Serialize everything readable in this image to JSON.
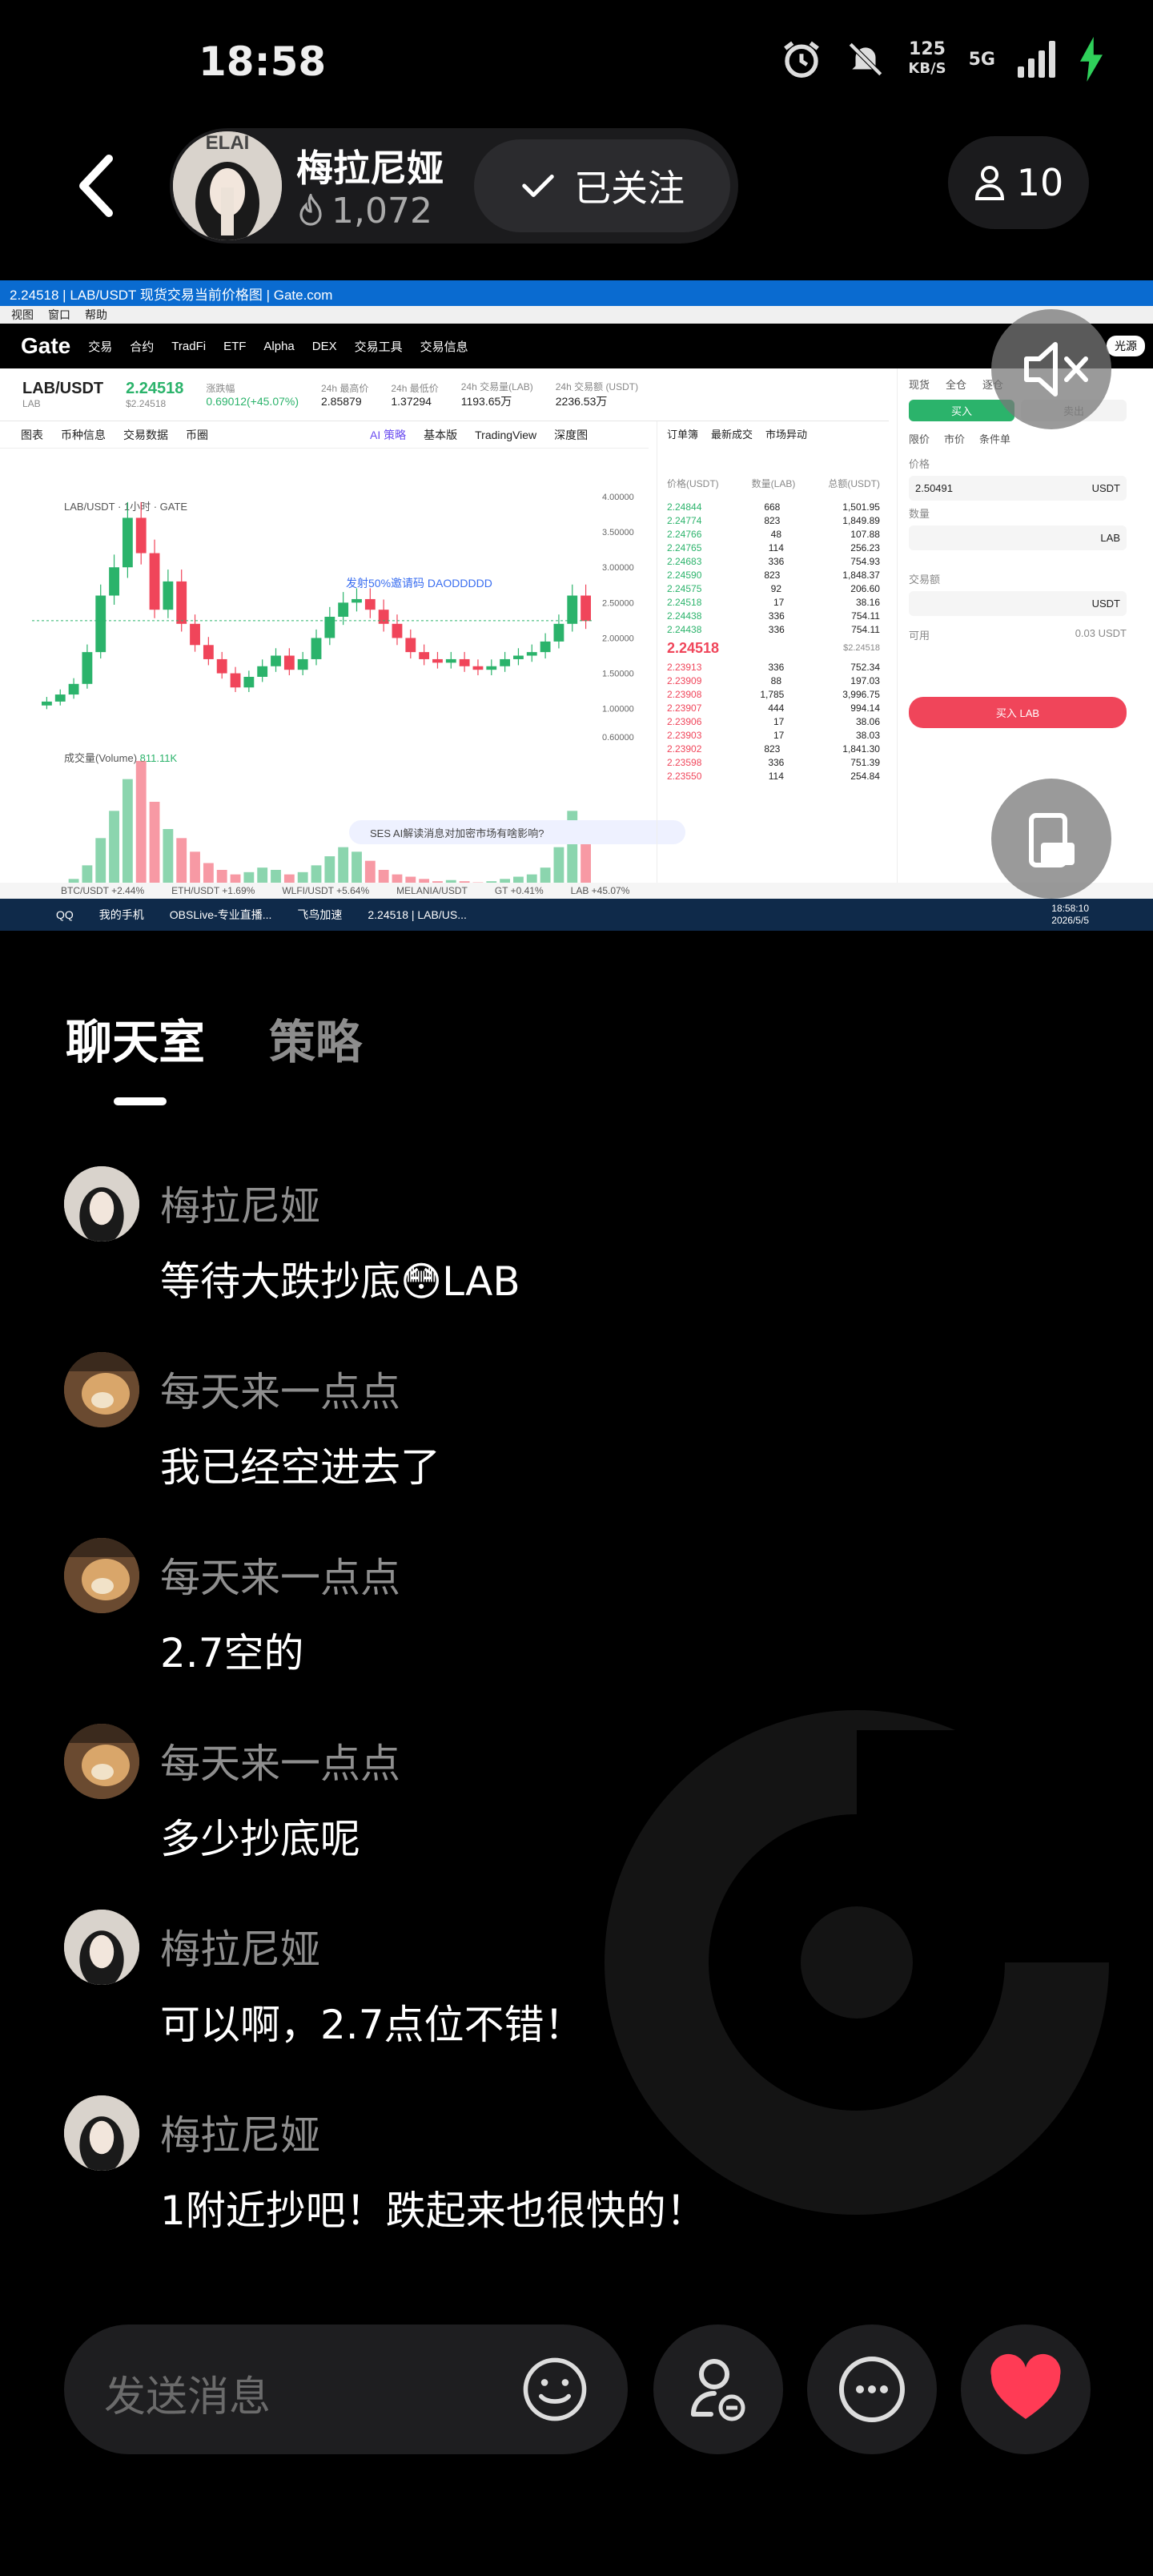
{
  "status_bar": {
    "time": "18:58",
    "net_speed_value": "125",
    "net_speed_unit": "KB/S",
    "network_type": "5G"
  },
  "header": {
    "host_name": "梅拉尼娅",
    "host_likes": "1,072",
    "follow_label": "已关注",
    "viewer_count": "10"
  },
  "stream": {
    "window_title": "2.24518 | LAB/USDT 现货交易当前价格图 | Gate.com",
    "window_menu": [
      "视图",
      "窗口",
      "帮助"
    ],
    "nav_items": [
      "交易",
      "合约",
      "TradFi",
      "ETF",
      "Alpha",
      "DEX",
      "交易工具",
      "交易信息"
    ],
    "logo": "Gate",
    "theme_toggle": "光源",
    "pair": "LAB/USDT",
    "pair_sub": "LAB",
    "last_price": "2.24518",
    "last_price_usd": "$2.24518",
    "change_label": "涨跌幅",
    "change_value": "0.69012(+45.07%)",
    "high_label": "24h 最高价",
    "high_value": "2.85879",
    "low_label": "24h 最低价",
    "low_value": "1.37294",
    "vol_label": "24h 交易量(LAB)",
    "vol_value": "1193.65万",
    "amount_label": "24h 交易额 (USDT)",
    "amount_value": "2236.53万",
    "tabs": [
      "图表",
      "币种信息",
      "交易数据",
      "币圈"
    ],
    "chart_tabs": [
      "AI 策略",
      "基本版",
      "TradingView",
      "深度图"
    ],
    "chart_header": "LAB/USDT · 1小时 · GATE",
    "chart_annotation": "发射50%邀请码 DAODDDDD",
    "volume_label": "成交量(Volume)",
    "volume_value": "811.11K",
    "y_ticks": [
      "4.00000",
      "3.50000",
      "3.00000",
      "2.50000",
      "2.00000",
      "1.50000",
      "1.00000",
      "0.60000"
    ],
    "book_tabs": [
      "订单簿",
      "最新成交",
      "市场异动"
    ],
    "book_header": [
      "价格(USDT)",
      "数量(LAB)",
      "总额(USDT)"
    ],
    "asks": [
      [
        "2.24844",
        "668",
        "1,501.95"
      ],
      [
        "2.24774",
        "823",
        "1,849.89"
      ],
      [
        "2.24766",
        "48",
        "107.88"
      ],
      [
        "2.24765",
        "114",
        "256.23"
      ],
      [
        "2.24683",
        "336",
        "754.93"
      ],
      [
        "2.24590",
        "823",
        "1,848.37"
      ],
      [
        "2.24575",
        "92",
        "206.60"
      ],
      [
        "2.24518",
        "17",
        "38.16"
      ],
      [
        "2.24438",
        "336",
        "754.11"
      ],
      [
        "2.24438",
        "336",
        "754.11"
      ]
    ],
    "mid_price": "2.24518",
    "mid_price_usd": "$2.24518",
    "bids": [
      [
        "2.23913",
        "336",
        "752.34"
      ],
      [
        "2.23909",
        "88",
        "197.03"
      ],
      [
        "2.23908",
        "1,785",
        "3,996.75"
      ],
      [
        "2.23907",
        "444",
        "994.14"
      ],
      [
        "2.23906",
        "17",
        "38.06"
      ],
      [
        "2.23903",
        "17",
        "38.03"
      ],
      [
        "2.23902",
        "823",
        "1,841.30"
      ],
      [
        "2.23598",
        "336",
        "751.39"
      ],
      [
        "2.23550",
        "114",
        "254.84"
      ]
    ],
    "trade_tabs": [
      "现货",
      "全仓",
      "逐仓"
    ],
    "buy_label": "买入",
    "sell_label": "卖出",
    "order_types": [
      "限价",
      "市价",
      "条件单"
    ],
    "price_label": "价格",
    "price_value": "2.50491",
    "quote": "USDT",
    "base": "LAB",
    "qty_label": "数量",
    "total_label": "交易额",
    "available_label": "可用",
    "available_value": "0.03 USDT",
    "buy_button": "买入 LAB",
    "ai_prompt": "SES AI解读消息对加密市场有啥影响?",
    "ticker_items": [
      "BTC/USDT +2.44%",
      "ETH/USDT +1.69%",
      "WLFI/USDT +5.64%",
      "MELANIA/USDT",
      "GT +0.41%",
      "LAB +45.07%"
    ],
    "taskbar_items": [
      "QQ",
      "我的手机",
      "OBSLive-专业直播...",
      "飞鸟加速",
      "2.24518 | LAB/US..."
    ],
    "taskbar_time": "18:58:10",
    "taskbar_date": "2026/5/5"
  },
  "chart_data": {
    "type": "candlestick",
    "x_unit": "1小时",
    "ylim": [
      0.6,
      4.0
    ],
    "close_series": [
      1.1,
      1.2,
      1.35,
      1.8,
      2.6,
      3.0,
      3.7,
      3.2,
      2.4,
      2.8,
      2.2,
      1.9,
      1.7,
      1.5,
      1.3,
      1.45,
      1.6,
      1.75,
      1.55,
      1.7,
      2.0,
      2.3,
      2.5,
      2.55,
      2.4,
      2.2,
      2.0,
      1.8,
      1.7,
      1.65,
      1.7,
      1.6,
      1.55,
      1.6,
      1.7,
      1.75,
      1.8,
      1.95,
      2.2,
      2.6,
      2.24
    ],
    "volume_series": [
      50,
      60,
      80,
      140,
      260,
      380,
      520,
      600,
      420,
      300,
      260,
      200,
      150,
      120,
      100,
      110,
      130,
      120,
      100,
      110,
      140,
      180,
      220,
      200,
      160,
      120,
      100,
      90,
      80,
      70,
      75,
      70,
      65,
      70,
      80,
      90,
      100,
      130,
      220,
      380,
      260
    ]
  },
  "tabs": {
    "chat": "聊天室",
    "strategy": "策略"
  },
  "messages": [
    {
      "user": "梅拉尼娅",
      "text": "等待大跌抄底😳LAB",
      "avatar": "host"
    },
    {
      "user": "每天来一点点",
      "text": "我已经空进去了",
      "avatar": "dog"
    },
    {
      "user": "每天来一点点",
      "text": "2.7空的",
      "avatar": "dog"
    },
    {
      "user": "每天来一点点",
      "text": "多少抄底呢",
      "avatar": "dog"
    },
    {
      "user": "梅拉尼娅",
      "text": "可以啊，2.7点位不错！",
      "avatar": "host"
    },
    {
      "user": "梅拉尼娅",
      "text": "1附近抄吧！跌起来也很快的！",
      "avatar": "host"
    }
  ],
  "input": {
    "placeholder": "发送消息"
  },
  "colors": {
    "like": "#ff3b55",
    "charging": "#2fd05a",
    "up": "#2bb36b",
    "down": "#f0455a"
  }
}
